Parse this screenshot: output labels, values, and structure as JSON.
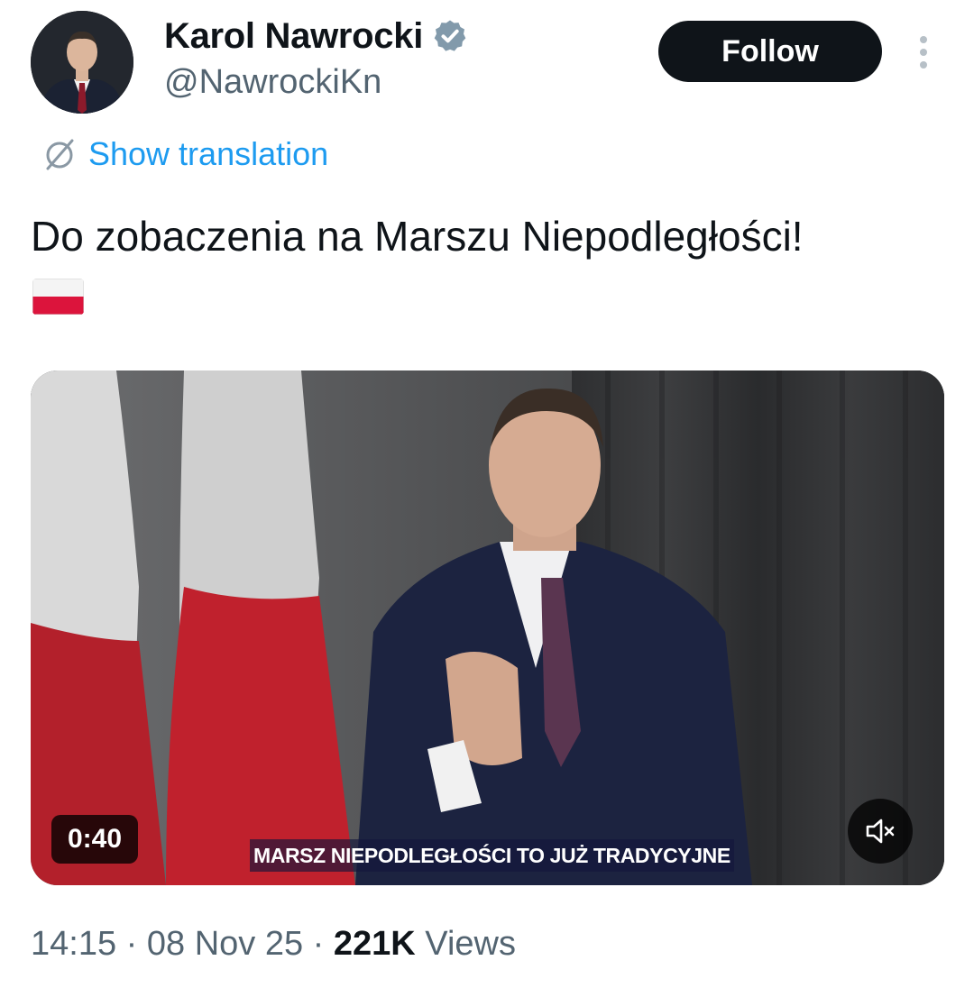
{
  "author": {
    "display_name": "Karol Nawrocki",
    "handle": "@NawrockiKn",
    "verified_icon": "verified-badge-icon"
  },
  "actions": {
    "follow_label": "Follow",
    "more_icon": "more-vertical-icon"
  },
  "translation": {
    "label": "Show translation",
    "icon": "globe-slash-icon"
  },
  "tweet": {
    "text": "Do zobaczenia na Marszu Niepodległości!",
    "emoji": "polish-flag-emoji"
  },
  "media": {
    "duration": "0:40",
    "caption": "MARSZ NIEPODLEGŁOŚCI TO JUŻ TRADYCYJNE",
    "mute_icon": "volume-muted-icon"
  },
  "meta": {
    "time": "14:15",
    "separator": "·",
    "date": "08 Nov 25",
    "views_count": "221K",
    "views_label": "Views"
  },
  "colors": {
    "accent": "#1d9bf0",
    "text_primary": "#0f1419",
    "text_secondary": "#536471",
    "flag_red": "#dc143c"
  }
}
